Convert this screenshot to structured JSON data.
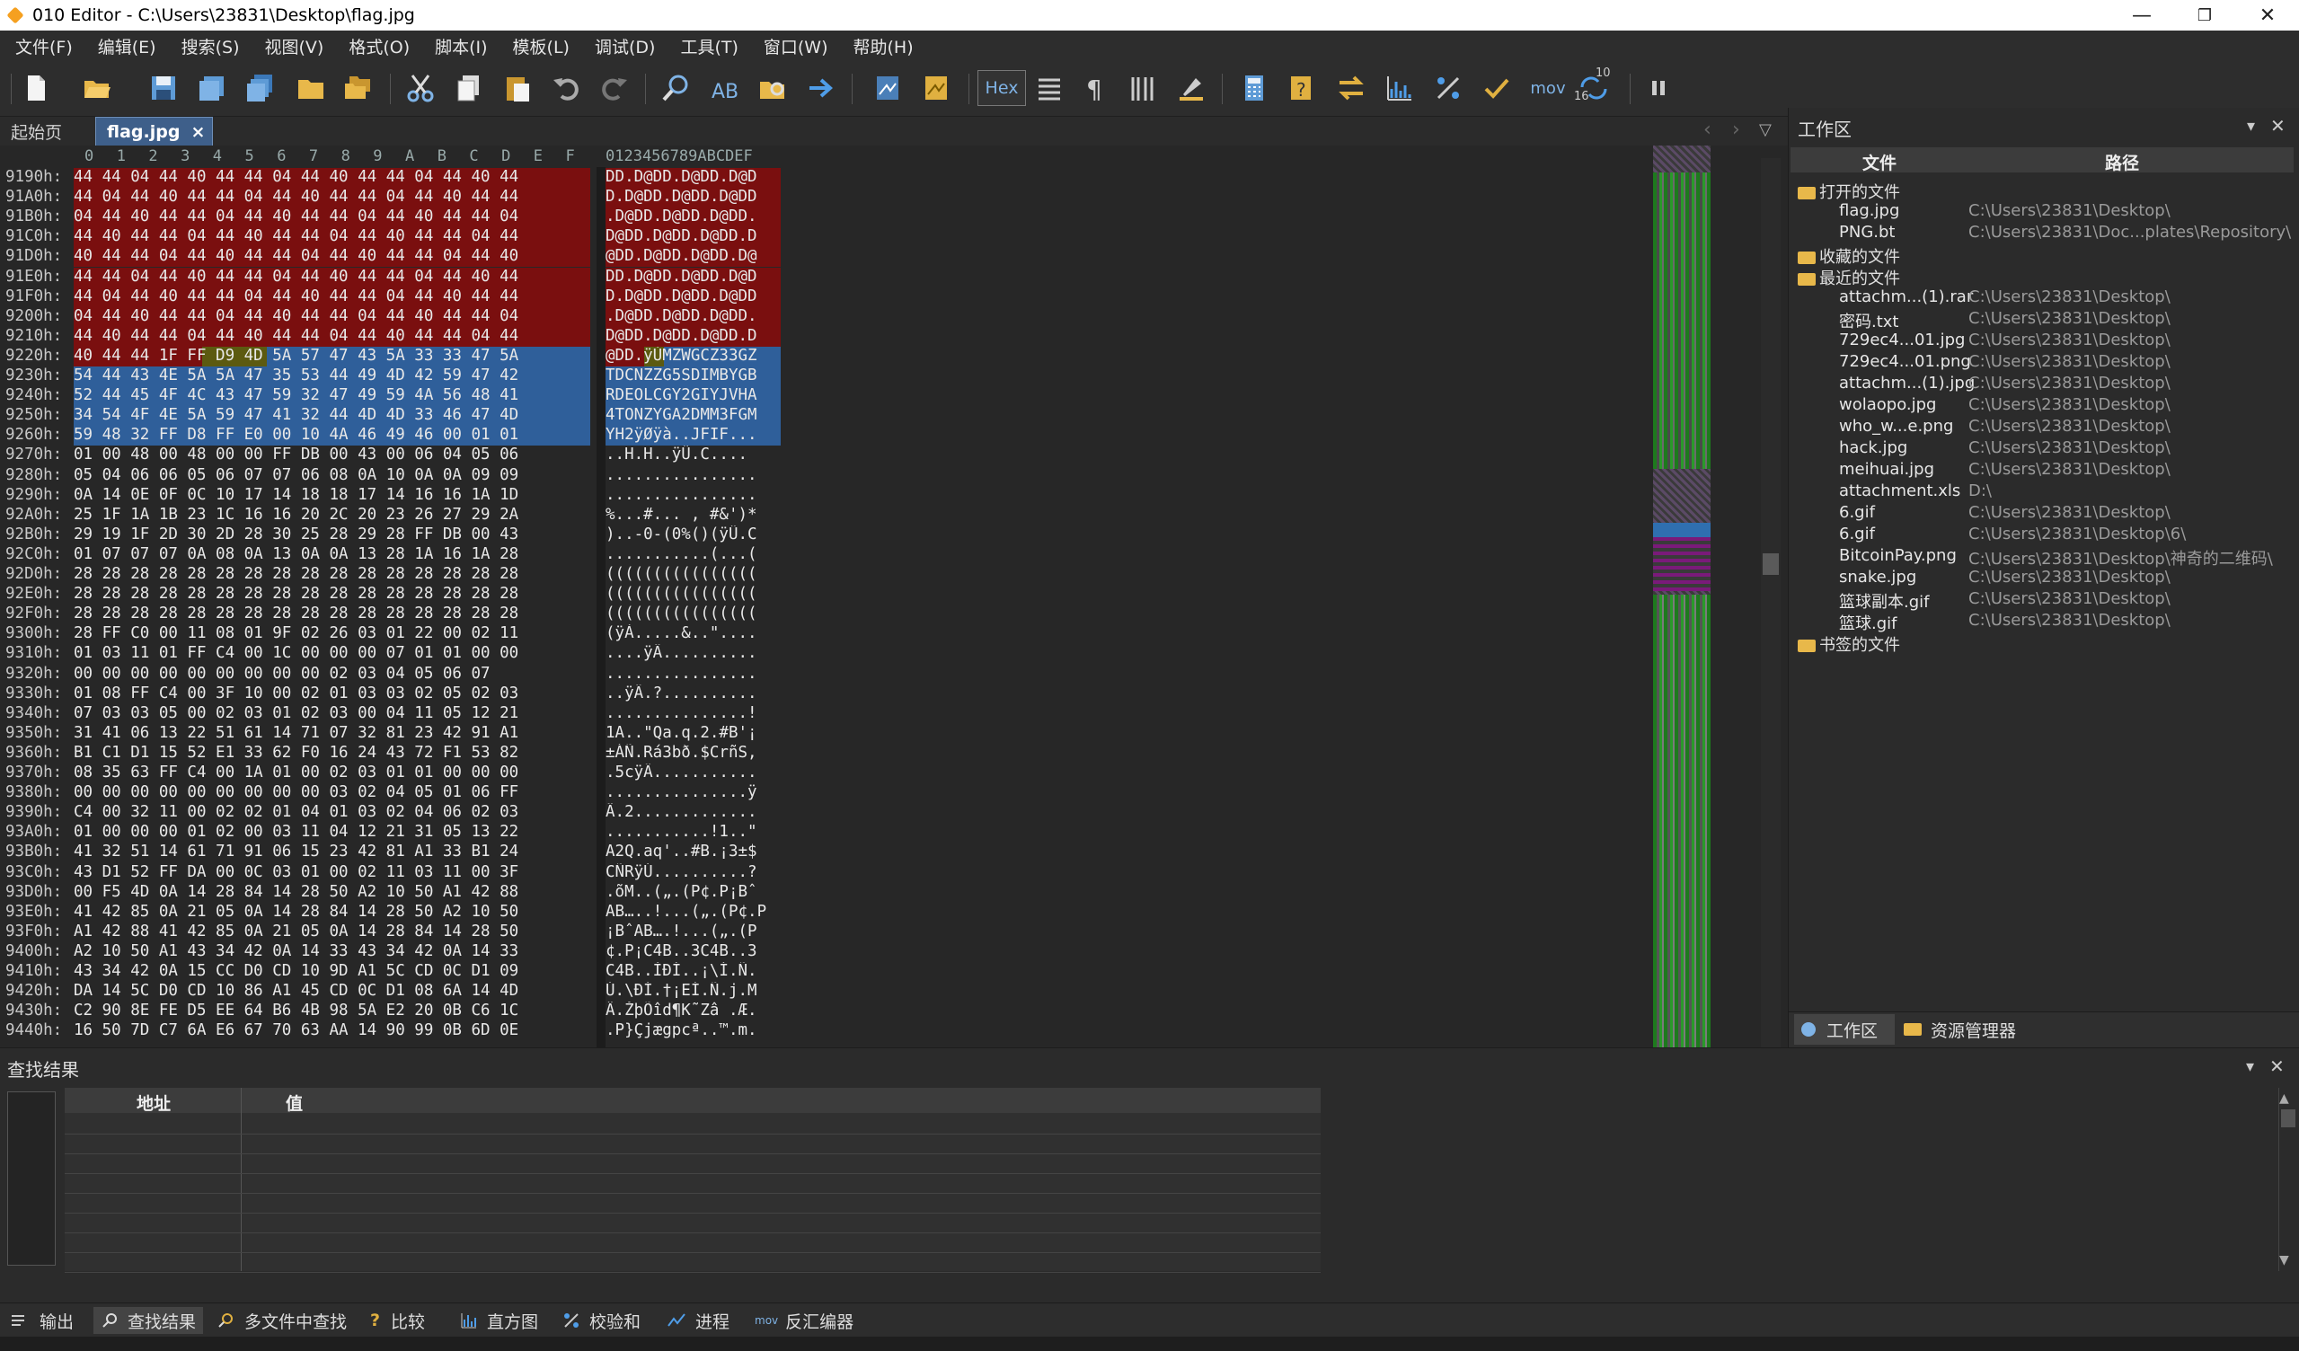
{
  "window": {
    "title": "010 Editor - C:\\Users\\23831\\Desktop\\flag.jpg",
    "minimize": "—",
    "restore": "❐",
    "close": "✕"
  },
  "menu": [
    "文件(F)",
    "编辑(E)",
    "搜索(S)",
    "视图(V)",
    "格式(O)",
    "脚本(I)",
    "模板(L)",
    "调试(D)",
    "工具(T)",
    "窗口(W)",
    "帮助(H)"
  ],
  "toolbar": {
    "hex_label": "Hex",
    "mov_label": "mov",
    "num_label_top": "10",
    "num_label_bottom": "16"
  },
  "tabs": {
    "start": "起始页",
    "active": "flag.jpg",
    "close": "×"
  },
  "hex": {
    "column_headers": [
      "0",
      "1",
      "2",
      "3",
      "4",
      "5",
      "6",
      "7",
      "8",
      "9",
      "A",
      "B",
      "C",
      "D",
      "E",
      "F"
    ],
    "ascii_header": "0123456789ABCDEF",
    "rows": [
      {
        "addr": "9190h:",
        "bytes": "44 44 04 44 40 44 44 04 44 40 44 44 04 44 40 44",
        "ascii": "DD.D@DD.D@DD.D@D"
      },
      {
        "addr": "91A0h:",
        "bytes": "44 04 44 40 44 44 04 44 40 44 44 04 44 40 44 44",
        "ascii": "D.D@DD.D@DD.D@DD"
      },
      {
        "addr": "91B0h:",
        "bytes": "04 44 40 44 44 04 44 40 44 44 04 44 40 44 44 04",
        "ascii": ".D@DD.D@DD.D@DD."
      },
      {
        "addr": "91C0h:",
        "bytes": "44 40 44 44 04 44 40 44 44 04 44 40 44 44 04 44",
        "ascii": "D@DD.D@DD.D@DD.D"
      },
      {
        "addr": "91D0h:",
        "bytes": "40 44 44 04 44 40 44 44 04 44 40 44 44 04 44 40",
        "ascii": "@DD.D@DD.D@DD.D@"
      },
      {
        "addr": "91E0h:",
        "bytes": "44 44 04 44 40 44 44 04 44 40 44 44 04 44 40 44",
        "ascii": "DD.D@DD.D@DD.D@D"
      },
      {
        "addr": "91F0h:",
        "bytes": "44 04 44 40 44 44 04 44 40 44 44 04 44 40 44 44",
        "ascii": "D.D@DD.D@DD.D@DD"
      },
      {
        "addr": "9200h:",
        "bytes": "04 44 40 44 44 04 44 40 44 44 04 44 40 44 44 04",
        "ascii": ".D@DD.D@DD.D@DD."
      },
      {
        "addr": "9210h:",
        "bytes": "44 40 44 44 04 44 40 44 44 04 44 40 44 44 04 44",
        "ascii": "D@DD.D@DD.D@DD.D"
      },
      {
        "addr": "9220h:",
        "bytes": "40 44 44 1F FF D9 4D 5A 57 47 43 5A 33 33 47 5A",
        "ascii": "@DD.ÿÙMZWGCZ33GZ"
      },
      {
        "addr": "9230h:",
        "bytes": "54 44 43 4E 5A 5A 47 35 53 44 49 4D 42 59 47 42",
        "ascii": "TDCNZZG5SDIMBYGB"
      },
      {
        "addr": "9240h:",
        "bytes": "52 44 45 4F 4C 43 47 59 32 47 49 59 4A 56 48 41",
        "ascii": "RDEOLCGY2GIYJVHA"
      },
      {
        "addr": "9250h:",
        "bytes": "34 54 4F 4E 5A 59 47 41 32 44 4D 4D 33 46 47 4D",
        "ascii": "4TONZYGA2DMM3FGM"
      },
      {
        "addr": "9260h:",
        "bytes": "59 48 32 FF D8 FF E0 00 10 4A 46 49 46 00 01 01",
        "ascii": "YH2ÿØÿà..JFIF..."
      },
      {
        "addr": "9270h:",
        "bytes": "01 00 48 00 48 00 00 FF DB 00 43 00 06 04 05 06",
        "ascii": "..H.H..ÿÛ.C...."
      },
      {
        "addr": "9280h:",
        "bytes": "05 04 06 06 05 06 07 07 06 08 0A 10 0A 0A 09 09",
        "ascii": "................"
      },
      {
        "addr": "9290h:",
        "bytes": "0A 14 0E 0F 0C 10 17 14 18 18 17 14 16 16 1A 1D",
        "ascii": "................"
      },
      {
        "addr": "92A0h:",
        "bytes": "25 1F 1A 1B 23 1C 16 16 20 2C 20 23 26 27 29 2A",
        "ascii": "%...#... , #&')*"
      },
      {
        "addr": "92B0h:",
        "bytes": "29 19 1F 2D 30 2D 28 30 25 28 29 28 FF DB 00 43",
        "ascii": ")..-0-(0%()(ÿÛ.C"
      },
      {
        "addr": "92C0h:",
        "bytes": "01 07 07 07 0A 08 0A 13 0A 0A 13 28 1A 16 1A 28",
        "ascii": "...........(...("
      },
      {
        "addr": "92D0h:",
        "bytes": "28 28 28 28 28 28 28 28 28 28 28 28 28 28 28 28",
        "ascii": "(((((((((((((((("
      },
      {
        "addr": "92E0h:",
        "bytes": "28 28 28 28 28 28 28 28 28 28 28 28 28 28 28 28",
        "ascii": "(((((((((((((((("
      },
      {
        "addr": "92F0h:",
        "bytes": "28 28 28 28 28 28 28 28 28 28 28 28 28 28 28 28",
        "ascii": "(((((((((((((((("
      },
      {
        "addr": "9300h:",
        "bytes": "28 FF C0 00 11 08 01 9F 02 26 03 01 22 00 02 11",
        "ascii": "(ÿÀ.....&..\"...."
      },
      {
        "addr": "9310h:",
        "bytes": "01 03 11 01 FF C4 00 1C 00 00 00 07 01 01 00 00",
        "ascii": "....ÿÄ.........."
      },
      {
        "addr": "9320h:",
        "bytes": "00 00 00 00 00 00 00 00 00 02 03 04 05 06 07",
        "ascii": "................"
      },
      {
        "addr": "9330h:",
        "bytes": "01 08 FF C4 00 3F 10 00 02 01 03 03 02 05 02 03",
        "ascii": "..ÿÄ.?.........."
      },
      {
        "addr": "9340h:",
        "bytes": "07 03 03 05 00 02 03 01 02 03 00 04 11 05 12 21",
        "ascii": "...............!"
      },
      {
        "addr": "9350h:",
        "bytes": "31 41 06 13 22 51 61 14 71 07 32 81 23 42 91 A1",
        "ascii": "1A..\"Qa.q.2.#B'¡"
      },
      {
        "addr": "9360h:",
        "bytes": "B1 C1 D1 15 52 E1 33 62 F0 16 24 43 72 F1 53 82",
        "ascii": "±ÁÑ.Rá3bð.$CrñS,"
      },
      {
        "addr": "9370h:",
        "bytes": "08 35 63 FF C4 00 1A 01 00 02 03 01 01 00 00 00",
        "ascii": ".5cÿÄ..........."
      },
      {
        "addr": "9380h:",
        "bytes": "00 00 00 00 00 00 00 00 00 03 02 04 05 01 06 FF",
        "ascii": "...............ÿ"
      },
      {
        "addr": "9390h:",
        "bytes": "C4 00 32 11 00 02 02 01 04 01 03 02 04 06 02 03",
        "ascii": "Ä.2............."
      },
      {
        "addr": "93A0h:",
        "bytes": "01 00 00 00 01 02 00 03 11 04 12 21 31 05 13 22",
        "ascii": "...........!1..\""
      },
      {
        "addr": "93B0h:",
        "bytes": "41 32 51 14 61 71 91 06 15 23 42 81 A1 33 B1 24",
        "ascii": "A2Q.aq'..#B.¡3±$"
      },
      {
        "addr": "93C0h:",
        "bytes": "43 D1 52 FF DA 00 0C 03 01 00 02 11 03 11 00 3F",
        "ascii": "CÑRÿÚ..........?"
      },
      {
        "addr": "93D0h:",
        "bytes": "00 F5 4D 0A 14 28 84 14 28 50 A2 10 50 A1 42 88",
        "ascii": ".õM..(„.(P¢.P¡Bˆ"
      },
      {
        "addr": "93E0h:",
        "bytes": "41 42 85 0A 21 05 0A 14 28 84 14 28 50 A2 10 50",
        "ascii": "AB…..!...(„.(P¢.P"
      },
      {
        "addr": "93F0h:",
        "bytes": "A1 42 88 41 42 85 0A 21 05 0A 14 28 84 14 28 50",
        "ascii": "¡BˆAB….!...(„.(P"
      },
      {
        "addr": "9400h:",
        "bytes": "A2 10 50 A1 43 34 42 0A 14 33 43 34 42 0A 14 33",
        "ascii": "¢.P¡C4B..3C4B..3"
      },
      {
        "addr": "9410h:",
        "bytes": "43 34 42 0A 15 CC D0 CD 10 9D A1 5C CD 0C D1 09",
        "ascii": "C4B..ÌÐÍ..¡\\Í.Ñ."
      },
      {
        "addr": "9420h:",
        "bytes": "DA 14 5C D0 CD 10 86 A1 45 CD 0C D1 08 6A 14 4D",
        "ascii": "Ú.\\ÐÍ.†¡EÍ.Ñ.j.M"
      },
      {
        "addr": "9430h:",
        "bytes": "C2 90 8E FE D5 EE 64 B6 4B 98 5A E2 20 0B C6 1C",
        "ascii": "Â.ŽþÕîd¶K˜Zâ .Æ."
      },
      {
        "addr": "9440h:",
        "bytes": "16 50 7D C7 6A E6 67 70 63 AA 14 90 99 0B 6D 0E",
        "ascii": ".P}Çjægpcª..™.m."
      }
    ]
  },
  "workspace": {
    "title": "工作区",
    "pin": "▾",
    "close": "✕",
    "col_file": "文件",
    "col_path": "路径",
    "open_files_label": "打开的文件",
    "open_files": [
      {
        "name": "flag.jpg",
        "path": "C:\\Users\\23831\\Desktop\\"
      },
      {
        "name": "PNG.bt",
        "path": "C:\\Users\\23831\\Doc...plates\\Repository\\"
      }
    ],
    "favorites_label": "收藏的文件",
    "recent_label": "最近的文件",
    "recent_files": [
      {
        "name": "attachm...(1).rar",
        "path": "C:\\Users\\23831\\Desktop\\"
      },
      {
        "name": "密码.txt",
        "path": "C:\\Users\\23831\\Desktop\\"
      },
      {
        "name": "729ec4...01.jpg",
        "path": "C:\\Users\\23831\\Desktop\\"
      },
      {
        "name": "729ec4...01.png",
        "path": "C:\\Users\\23831\\Desktop\\"
      },
      {
        "name": "attachm...(1).jpg",
        "path": "C:\\Users\\23831\\Desktop\\"
      },
      {
        "name": "wolaopo.jpg",
        "path": "C:\\Users\\23831\\Desktop\\"
      },
      {
        "name": "who_w...e.png",
        "path": "C:\\Users\\23831\\Desktop\\"
      },
      {
        "name": "hack.jpg",
        "path": "C:\\Users\\23831\\Desktop\\"
      },
      {
        "name": "meihuai.jpg",
        "path": "C:\\Users\\23831\\Desktop\\"
      },
      {
        "name": "attachment.xls",
        "path": "D:\\"
      },
      {
        "name": "6.gif",
        "path": "C:\\Users\\23831\\Desktop\\"
      },
      {
        "name": "6.gif",
        "path": "C:\\Users\\23831\\Desktop\\6\\"
      },
      {
        "name": "BitcoinPay.png",
        "path": "C:\\Users\\23831\\Desktop\\神奇的二维码\\"
      },
      {
        "name": "snake.jpg",
        "path": "C:\\Users\\23831\\Desktop\\"
      },
      {
        "name": "篮球副本.gif",
        "path": "C:\\Users\\23831\\Desktop\\"
      },
      {
        "name": "篮球.gif",
        "path": "C:\\Users\\23831\\Desktop\\"
      }
    ],
    "bookmarks_label": "书签的文件",
    "tab_workspace": "工作区",
    "tab_explorer": "资源管理器"
  },
  "find": {
    "title": "查找结果",
    "col_addr": "地址",
    "col_value": "值"
  },
  "bottom_tabs": [
    "输出",
    "查找结果",
    "多文件中查找",
    "比较",
    "直方图",
    "校验和",
    "进程",
    "反汇编器"
  ]
}
